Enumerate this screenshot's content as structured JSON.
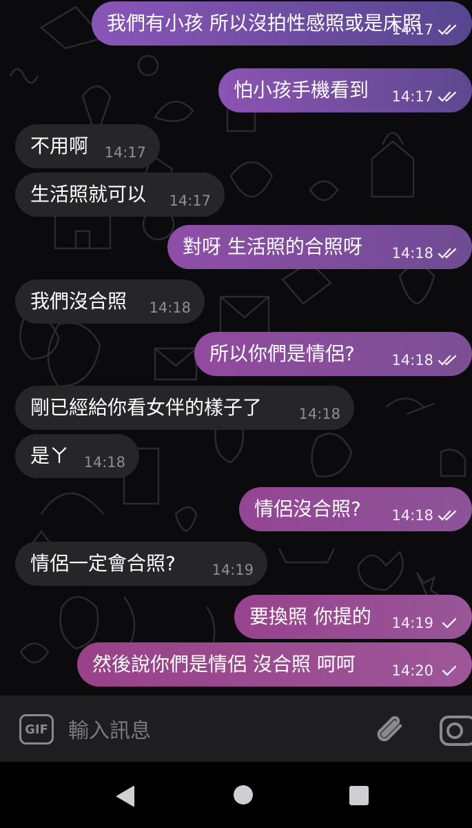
{
  "messages": [
    {
      "dir": "out",
      "text": "我們有小孩 所以沒拍性感照或是床照",
      "time": "14:17",
      "status": "read"
    },
    {
      "dir": "out",
      "text": "怕小孩手機看到",
      "time": "14:17",
      "status": "read"
    },
    {
      "dir": "in",
      "text": "不用啊",
      "time": "14:17"
    },
    {
      "dir": "in",
      "text": "生活照就可以",
      "time": "14:17"
    },
    {
      "dir": "out",
      "text": "對呀 生活照的合照呀",
      "time": "14:18",
      "status": "read"
    },
    {
      "dir": "in",
      "text": "我們沒合照",
      "time": "14:18"
    },
    {
      "dir": "out",
      "text": "所以你們是情侶?",
      "time": "14:18",
      "status": "read"
    },
    {
      "dir": "in",
      "text": "剛已經給你看女伴的樣子了",
      "time": "14:18"
    },
    {
      "dir": "in",
      "text": "是ㄚ",
      "time": "14:18"
    },
    {
      "dir": "out",
      "text": "情侶沒合照?",
      "time": "14:18",
      "status": "read"
    },
    {
      "dir": "in",
      "text": "情侶一定會合照?",
      "time": "14:19"
    },
    {
      "dir": "out",
      "text": "要換照 你提的",
      "time": "14:19",
      "status": "sent"
    },
    {
      "dir": "out",
      "text": "然後說你們是情侶 沒合照 呵呵",
      "time": "14:20",
      "status": "sent"
    }
  ],
  "input": {
    "gif_label": "GIF",
    "placeholder": "輸入訊息",
    "gif_icon": "gif-icon",
    "attach_icon": "paperclip-icon",
    "camera_icon": "camera-icon"
  },
  "navbar": {
    "back_icon": "back-triangle-icon",
    "home_icon": "home-circle-icon",
    "recents_icon": "recents-square-icon"
  },
  "colors": {
    "background": "#0b0b0d",
    "incoming_bubble": "#262629",
    "outgoing_gradient_top": [
      "#8a55b8",
      "#56468f"
    ],
    "outgoing_gradient_bottom": [
      "#9a3f86",
      "#a2589a"
    ],
    "input_bar": "#1e1e20",
    "nav_bar": "#000000"
  }
}
